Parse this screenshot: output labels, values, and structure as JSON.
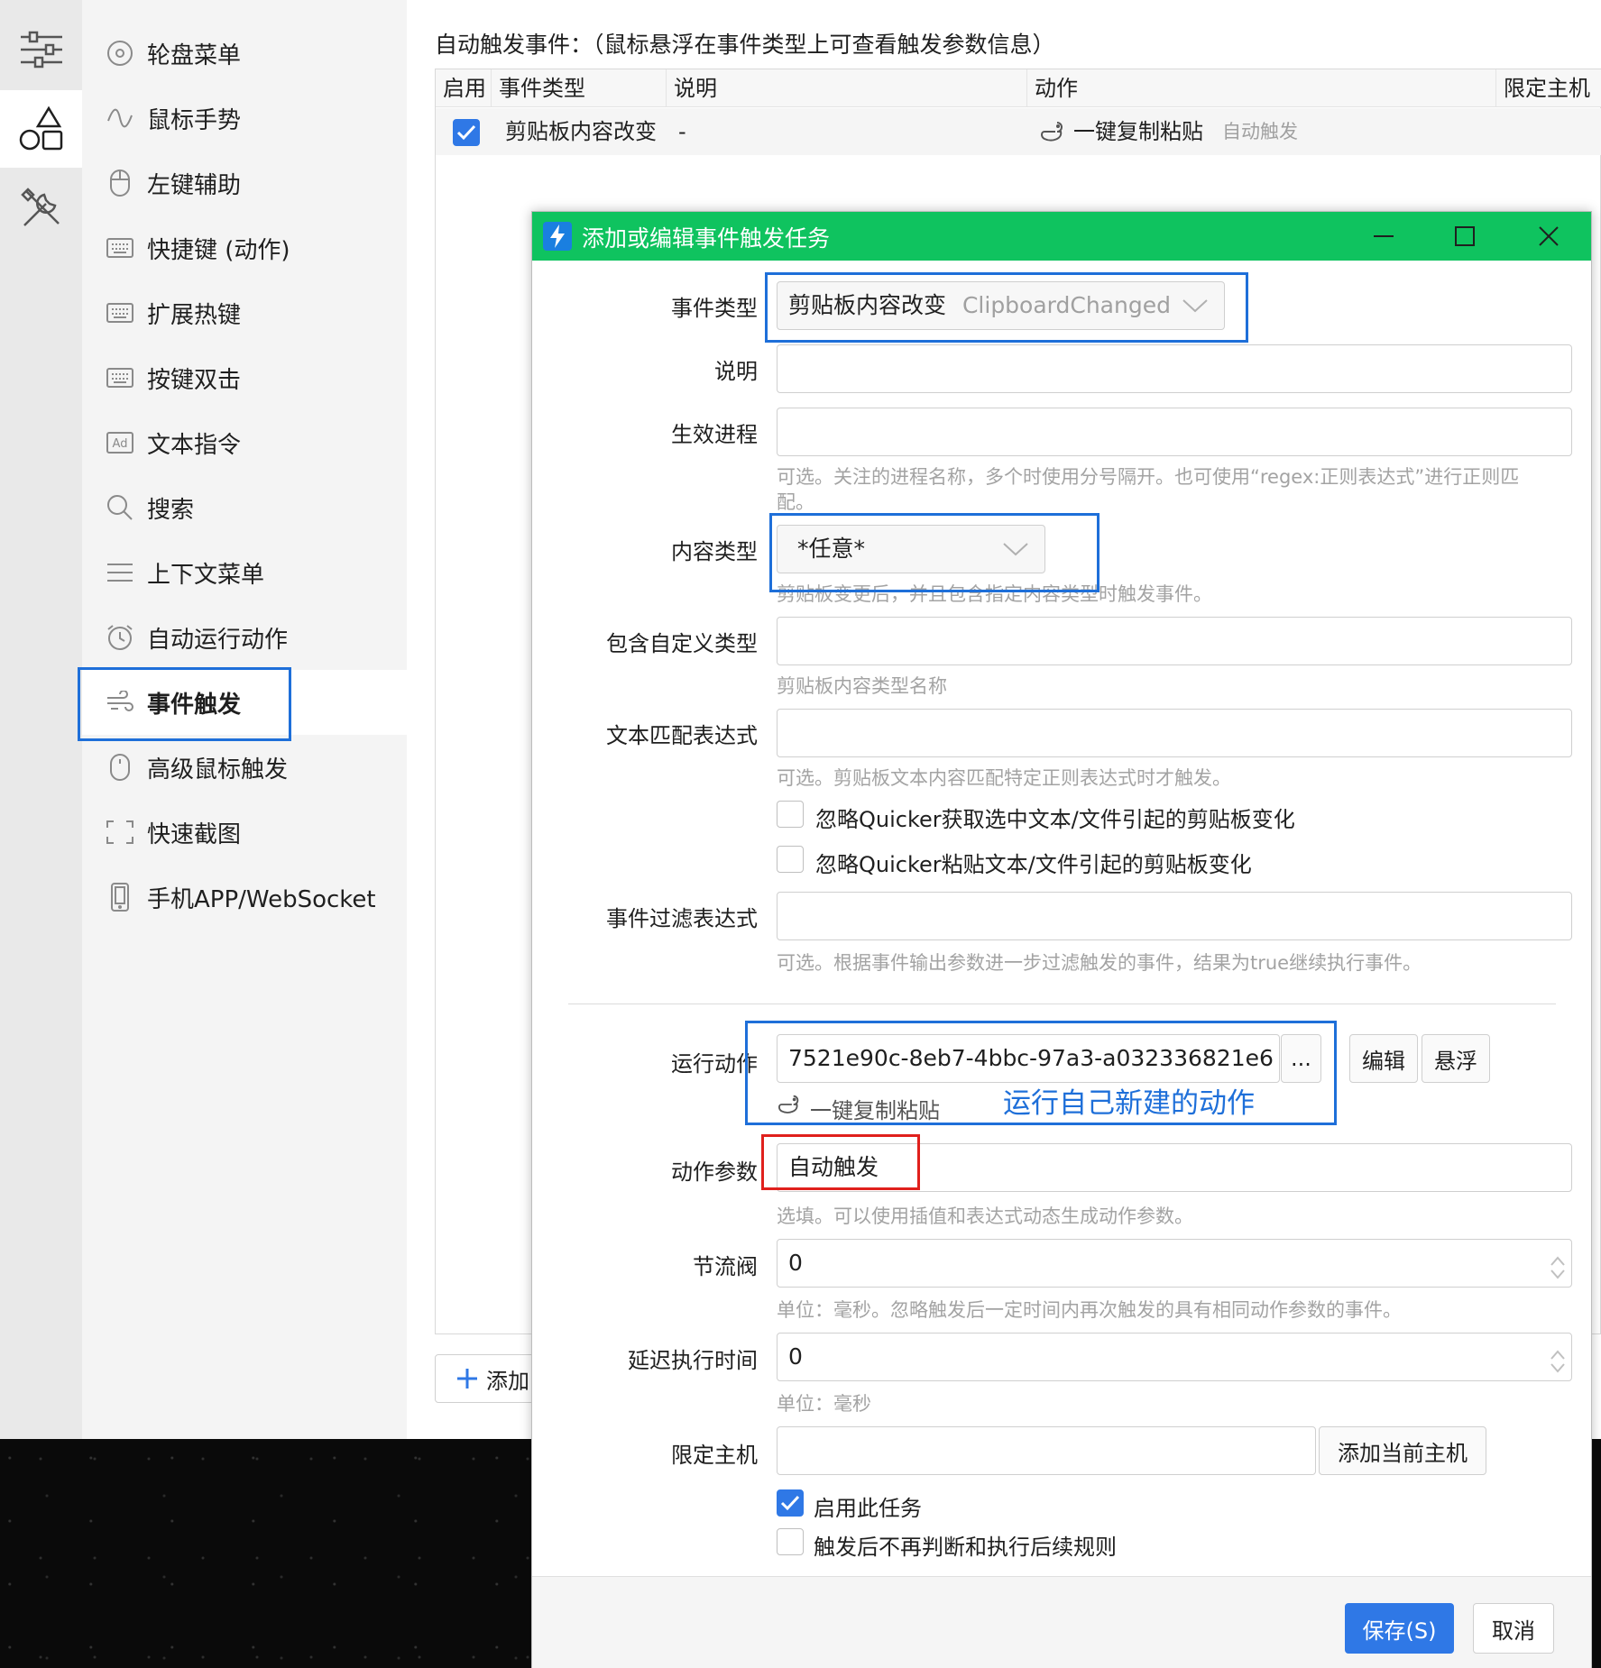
{
  "colors": {
    "accent": "#2f78e6",
    "titlebar": "#0fc35f",
    "highlight_blue": "#1e6fd9",
    "highlight_red": "#e0201c"
  },
  "rail": {
    "items": [
      {
        "icon": "sliders-icon"
      },
      {
        "icon": "shapes-icon"
      },
      {
        "icon": "tools-icon"
      }
    ]
  },
  "menu": {
    "items": [
      {
        "label": "轮盘菜单",
        "icon": "wheel-icon"
      },
      {
        "label": "鼠标手势",
        "icon": "gesture-icon"
      },
      {
        "label": "左键辅助",
        "icon": "mouse-icon"
      },
      {
        "label": "快捷键 (动作)",
        "icon": "keyboard-icon"
      },
      {
        "label": "扩展热键",
        "icon": "keyboard-icon"
      },
      {
        "label": "按键双击",
        "icon": "keyboard-icon"
      },
      {
        "label": "文本指令",
        "icon": "ad-icon"
      },
      {
        "label": "搜索",
        "icon": "search-icon"
      },
      {
        "label": "上下文菜单",
        "icon": "menu-lines-icon"
      },
      {
        "label": "自动运行动作",
        "icon": "alarm-icon"
      },
      {
        "label": "事件触发",
        "icon": "event-icon"
      },
      {
        "label": "高级鼠标触发",
        "icon": "mouse-icon"
      },
      {
        "label": "快速截图",
        "icon": "screenshot-icon"
      },
      {
        "label": "手机APP/WebSocket",
        "icon": "phone-icon"
      }
    ]
  },
  "main": {
    "title": "自动触发事件：（鼠标悬浮在事件类型上可查看触发参数信息）",
    "columns": [
      "启用",
      "事件类型",
      "说明",
      "动作",
      "限定主机"
    ],
    "row": {
      "enabled": true,
      "event_type": "剪贴板内容改变",
      "desc": "-",
      "action": "一键复制粘贴",
      "action_param": "自动触发"
    },
    "add_label": "添加"
  },
  "dialog": {
    "title": "添加或编辑事件触发任务",
    "fields": {
      "event_type": {
        "label": "事件类型",
        "value": "剪贴板内容改变",
        "value_en": "ClipboardChanged"
      },
      "desc": {
        "label": "说明",
        "value": ""
      },
      "process": {
        "label": "生效进程",
        "value": "",
        "hint1": "可选。关注的进程名称，多个时使用分号隔开。也可使用“regex:正则表达式”进行正则匹",
        "hint2": "配。"
      },
      "content_type": {
        "label": "内容类型",
        "value": "*任意*",
        "hint": "剪贴板变更后，并且包含指定内容类型时触发事件。"
      },
      "custom_type": {
        "label": "包含自定义类型",
        "value": "",
        "hint": "剪贴板内容类型名称"
      },
      "text_regex": {
        "label": "文本匹配表达式",
        "value": "",
        "hint": "可选。剪贴板文本内容匹配特定正则表达式时才触发。"
      },
      "ignore_get": "忽略Quicker获取选中文本/文件引起的剪贴板变化",
      "ignore_paste": "忽略Quicker粘贴文本/文件引起的剪贴板变化",
      "filter": {
        "label": "事件过滤表达式",
        "value": "",
        "hint": "可选。根据事件输出参数进一步过滤触发的事件，结果为true继续执行事件。"
      },
      "run_action": {
        "label": "运行动作",
        "value": "7521e90c-8eb7-4bbc-97a3-a032336821e6",
        "more": "...",
        "edit": "编辑",
        "float": "悬浮",
        "action_name": "一键复制粘贴",
        "annotation": "运行自己新建的动作"
      },
      "action_param": {
        "label": "动作参数",
        "value": "自动触发",
        "hint": "选填。可以使用插值和表达式动态生成动作参数。"
      },
      "throttle": {
        "label": "节流阀",
        "value": "0",
        "hint": "单位：毫秒。忽略触发后一定时间内再次触发的具有相同动作参数的事件。"
      },
      "delay": {
        "label": "延迟执行时间",
        "value": "0",
        "hint": "单位：毫秒"
      },
      "host": {
        "label": "限定主机",
        "value": "",
        "button": "添加当前主机"
      },
      "enable_task": {
        "label": "启用此任务",
        "checked": true
      },
      "stop_after": {
        "label": "触发后不再判断和执行后续规则",
        "checked": false
      }
    },
    "save": "保存(S)",
    "cancel": "取消"
  }
}
